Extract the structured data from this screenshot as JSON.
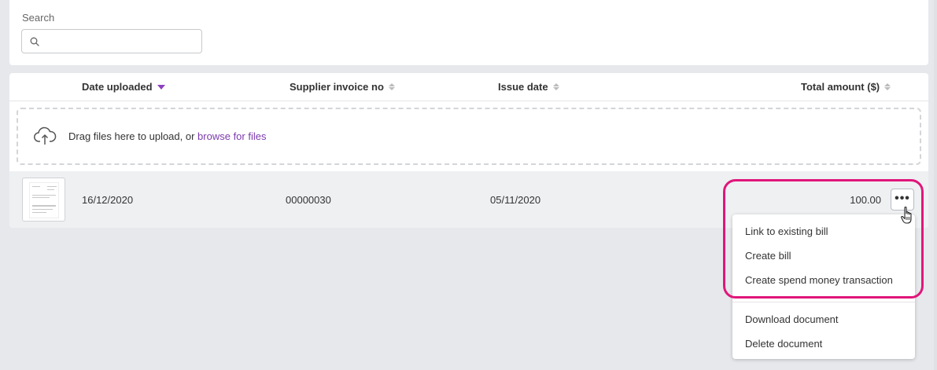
{
  "search": {
    "label": "Search",
    "value": "",
    "placeholder": ""
  },
  "table": {
    "columns": [
      {
        "label": "Date uploaded",
        "sort": "descending"
      },
      {
        "label": "Supplier invoice no",
        "sort": "none"
      },
      {
        "label": "Issue date",
        "sort": "none"
      },
      {
        "label": "Total amount ($)",
        "sort": "none"
      }
    ],
    "upload": {
      "text": "Drag files here to upload, or ",
      "link": "browse for files"
    },
    "rows": [
      {
        "date_uploaded": "16/12/2020",
        "supplier_invoice_no": "00000030",
        "issue_date": "05/11/2020",
        "total_amount": "100.00",
        "more": "•••"
      }
    ]
  },
  "menu": {
    "items": [
      {
        "label": "Link to existing bill"
      },
      {
        "label": "Create bill"
      },
      {
        "label": "Create spend money transaction"
      },
      {
        "label": "Download document"
      },
      {
        "label": "Delete document"
      }
    ]
  },
  "colors": {
    "accent": "#7c3aad",
    "highlight": "#e0167a",
    "background": "#e6e8ec"
  },
  "icons": {
    "search": "search-icon",
    "upload": "cloud-upload-icon",
    "more": "more-options-icon",
    "cursor": "hand-pointer-icon"
  }
}
